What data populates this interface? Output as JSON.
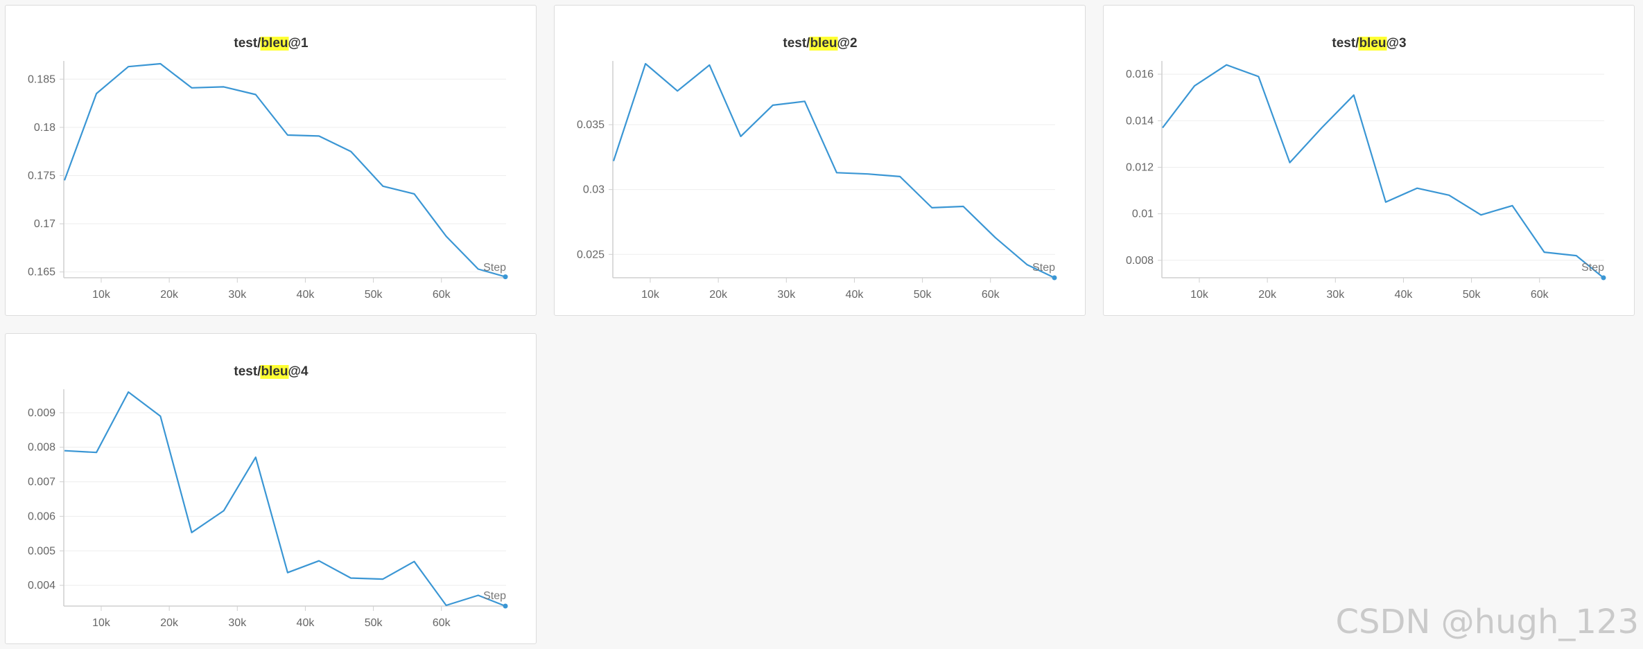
{
  "colors": {
    "line": "#3a96d4",
    "highlight": "#ffff33",
    "grid": "#ededed",
    "axis": "#cfcfcf"
  },
  "watermark": "CSDN @hugh_123",
  "chart_data": [
    {
      "type": "line",
      "title_prefix": "test/",
      "title_highlight": "bleu",
      "title_suffix": "@1",
      "xlabel": "Step",
      "x_ticks": [
        10000,
        20000,
        30000,
        40000,
        50000,
        60000
      ],
      "x_tick_labels": [
        "10k",
        "20k",
        "30k",
        "40k",
        "50k",
        "60k"
      ],
      "y_ticks": [
        0.165,
        0.17,
        0.175,
        0.18,
        0.185
      ],
      "y_tick_labels": [
        "0.165",
        "0.17",
        "0.175",
        "0.18",
        "0.185"
      ],
      "xlim": [
        4500,
        69500
      ],
      "ylim": [
        0.1644,
        0.1866
      ],
      "x": [
        4600,
        9300,
        14000,
        18700,
        23300,
        28000,
        32700,
        37400,
        42000,
        46700,
        51400,
        56000,
        60700,
        65400,
        69400
      ],
      "y": [
        0.1745,
        0.1835,
        0.1863,
        0.1866,
        0.1841,
        0.1842,
        0.1834,
        0.1792,
        0.1791,
        0.1775,
        0.1739,
        0.1731,
        0.1687,
        0.1653,
        0.1645
      ]
    },
    {
      "type": "line",
      "title_prefix": "test/",
      "title_highlight": "bleu",
      "title_suffix": "@2",
      "xlabel": "Step",
      "x_ticks": [
        10000,
        20000,
        30000,
        40000,
        50000,
        60000
      ],
      "x_tick_labels": [
        "10k",
        "20k",
        "30k",
        "40k",
        "50k",
        "60k"
      ],
      "y_ticks": [
        0.025,
        0.03,
        0.035
      ],
      "y_tick_labels": [
        "0.025",
        "0.03",
        "0.035"
      ],
      "xlim": [
        4500,
        69500
      ],
      "ylim": [
        0.0232,
        0.0397
      ],
      "x": [
        4600,
        9300,
        14000,
        18700,
        23300,
        28000,
        32700,
        37400,
        42000,
        46700,
        51400,
        56000,
        60700,
        65400,
        69400
      ],
      "y": [
        0.0322,
        0.0397,
        0.0376,
        0.0396,
        0.0341,
        0.0365,
        0.0368,
        0.0313,
        0.0312,
        0.031,
        0.0286,
        0.0287,
        0.0263,
        0.0242,
        0.0232
      ]
    },
    {
      "type": "line",
      "title_prefix": "test/",
      "title_highlight": "bleu",
      "title_suffix": "@3",
      "xlabel": "Step",
      "x_ticks": [
        10000,
        20000,
        30000,
        40000,
        50000,
        60000
      ],
      "x_tick_labels": [
        "10k",
        "20k",
        "30k",
        "40k",
        "50k",
        "60k"
      ],
      "y_ticks": [
        0.008,
        0.01,
        0.012,
        0.014,
        0.016
      ],
      "y_tick_labels": [
        "0.008",
        "0.01",
        "0.012",
        "0.014",
        "0.016"
      ],
      "xlim": [
        4500,
        69500
      ],
      "ylim": [
        0.00725,
        0.01645
      ],
      "x": [
        4600,
        9300,
        14000,
        18700,
        23300,
        28000,
        32700,
        37400,
        42000,
        46700,
        51400,
        56000,
        60700,
        65400,
        69400
      ],
      "y": [
        0.0137,
        0.0155,
        0.0164,
        0.0159,
        0.0122,
        0.0137,
        0.0151,
        0.0105,
        0.0111,
        0.0108,
        0.00995,
        0.01035,
        0.00835,
        0.0082,
        0.00725
      ]
    },
    {
      "type": "line",
      "title_prefix": "test/",
      "title_highlight": "bleu",
      "title_suffix": "@4",
      "xlabel": "Step",
      "x_ticks": [
        10000,
        20000,
        30000,
        40000,
        50000,
        60000
      ],
      "x_tick_labels": [
        "10k",
        "20k",
        "30k",
        "40k",
        "50k",
        "60k"
      ],
      "y_ticks": [
        0.004,
        0.005,
        0.006,
        0.007,
        0.008,
        0.009
      ],
      "y_tick_labels": [
        "0.004",
        "0.005",
        "0.006",
        "0.007",
        "0.008",
        "0.009"
      ],
      "xlim": [
        4500,
        69500
      ],
      "ylim": [
        0.0034,
        0.0096
      ],
      "x": [
        4600,
        9300,
        14000,
        18700,
        23300,
        28000,
        32700,
        37400,
        42000,
        46700,
        51400,
        56000,
        60700,
        65400,
        69400
      ],
      "y": [
        0.0079,
        0.00785,
        0.0096,
        0.0089,
        0.00553,
        0.00616,
        0.00771,
        0.00437,
        0.00471,
        0.00421,
        0.00418,
        0.00469,
        0.00342,
        0.00371,
        0.0034
      ]
    }
  ]
}
